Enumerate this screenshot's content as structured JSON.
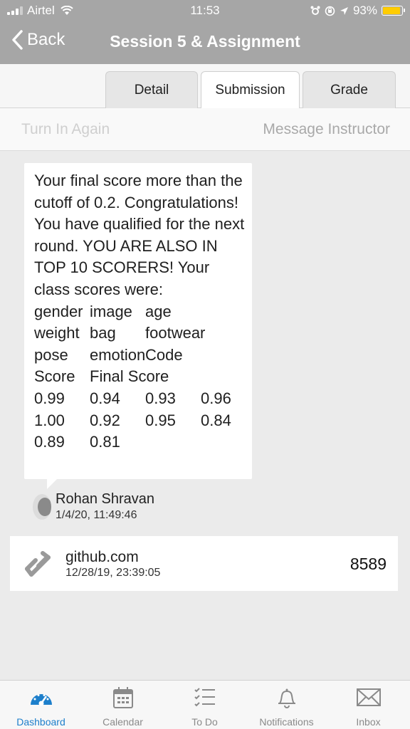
{
  "status_bar": {
    "carrier": "Airtel",
    "time": "11:53",
    "battery_text": "93%",
    "battery_level": 0.93,
    "battery_color": "#ffcc00"
  },
  "nav": {
    "back_label": "Back",
    "title": "Session 5 & Assignment"
  },
  "tabs": [
    {
      "label": "Detail",
      "active": false
    },
    {
      "label": "Submission",
      "active": true
    },
    {
      "label": "Grade",
      "active": false
    }
  ],
  "actions": {
    "turn_in_again": "Turn In Again",
    "message_instructor": "Message Instructor"
  },
  "comment": {
    "message": "Your final score more than the cutoff of 0.2. Congratulations! You have qualified for the next round. YOU ARE ALSO IN TOP 10 SCORERS! Your class scores were:",
    "score_grid": [
      [
        "gender",
        "image",
        "age",
        ""
      ],
      [
        "weight",
        "bag",
        "footwear",
        ""
      ],
      [
        "pose",
        "emotion",
        "Code",
        ""
      ],
      [
        "Score",
        "Final Score",
        "",
        ""
      ],
      [
        "0.99",
        "0.94",
        "0.93",
        "0.96"
      ],
      [
        "1.00",
        "0.92",
        "0.95",
        "0.84"
      ],
      [
        "0.89",
        "0.81",
        "",
        ""
      ]
    ],
    "author": "Rohan Shravan",
    "timestamp": "1/4/20, 11:49:46"
  },
  "link_attachment": {
    "title": "github.com",
    "timestamp": "12/28/19, 23:39:05",
    "value": "8589"
  },
  "bottom_tabs": [
    {
      "label": "Dashboard",
      "icon": "dashboard-icon",
      "active": true
    },
    {
      "label": "Calendar",
      "icon": "calendar-icon",
      "active": false
    },
    {
      "label": "To Do",
      "icon": "todo-icon",
      "active": false
    },
    {
      "label": "Notifications",
      "icon": "bell-icon",
      "active": false
    },
    {
      "label": "Inbox",
      "icon": "inbox-icon",
      "active": false
    }
  ],
  "colors": {
    "header_bg": "#a6a6a6",
    "accent": "#1d7fcb",
    "page_bg": "#ebebeb"
  }
}
